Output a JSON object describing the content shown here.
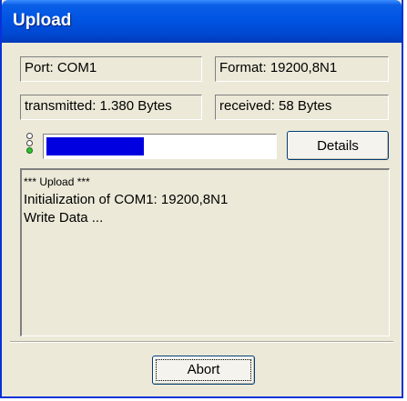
{
  "window": {
    "title": "Upload"
  },
  "fields": {
    "port": "Port: COM1",
    "format": "Format: 19200,8N1",
    "transmitted": "transmitted: 1.380 Bytes",
    "received": "received: 58 Bytes"
  },
  "status_leds": [
    {
      "state": "off"
    },
    {
      "state": "off"
    },
    {
      "state": "on",
      "color": "#2fc42f"
    }
  ],
  "progress": {
    "fraction": 0.43,
    "fill_color": "#0000e0"
  },
  "buttons": {
    "details_label": "Details",
    "abort_label": "Abort"
  },
  "log": {
    "lines": [
      "*** Upload ***",
      "Initialization of COM1: 19200,8N1",
      "Write Data ..."
    ]
  },
  "colors": {
    "titlebar": "#0054e3",
    "dialog_face": "#ece9d8"
  }
}
